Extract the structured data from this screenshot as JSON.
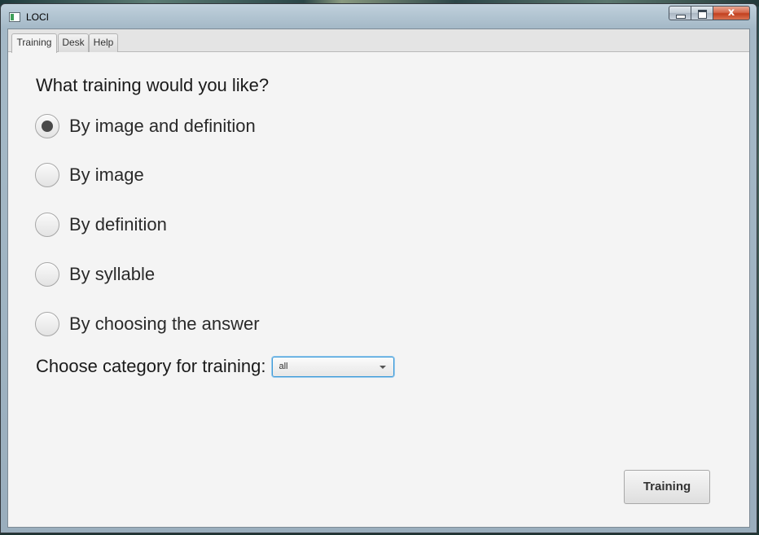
{
  "window": {
    "title": "LOCI",
    "controls": {
      "minimize": "minimize",
      "maximize": "maximize",
      "close": "x"
    }
  },
  "tabs": [
    {
      "label": "Training",
      "selected": true
    },
    {
      "label": "Desk",
      "selected": false
    },
    {
      "label": "Help",
      "selected": false
    }
  ],
  "training": {
    "heading": "What training would you like?",
    "options": [
      {
        "label": "By image and definition",
        "checked": true
      },
      {
        "label": "By image",
        "checked": false
      },
      {
        "label": "By definition",
        "checked": false
      },
      {
        "label": "By syllable",
        "checked": false
      },
      {
        "label": "By choosing the answer",
        "checked": false
      }
    ],
    "category_label": "Choose category for training:",
    "category_selected": "all",
    "button_label": "Training"
  },
  "colors": {
    "focus_accent": "#3b99d8",
    "close_button": "#c2401f",
    "content_background": "#f4f4f4"
  },
  "icons": {
    "app": "app-icon",
    "dropdown": "chevron-down-icon"
  }
}
